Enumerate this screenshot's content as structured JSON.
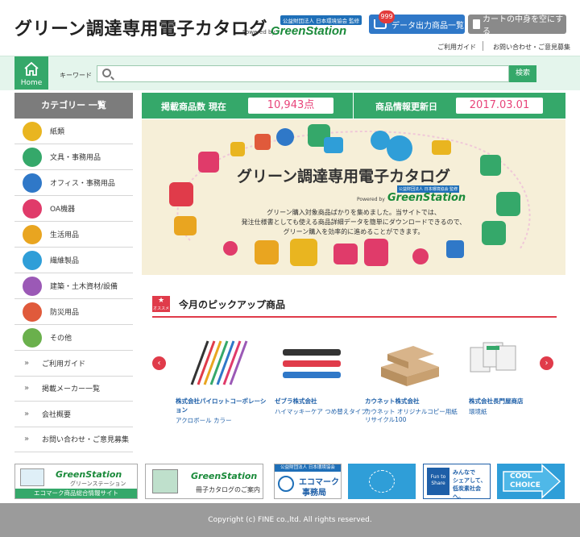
{
  "header": {
    "site_title": "グリーン調達専用電子カタログ",
    "powered_by": "Powered by",
    "brand": "GreenStation",
    "brand_org": "公益財団法人 日本環境協会 監修",
    "export_button": "データ出力商品一覧",
    "export_badge": "999",
    "empty_cart_button": "カートの中身を空にする",
    "link_guide": "ご利用ガイド",
    "link_contact": "お問い合わせ・ご意見募集"
  },
  "search": {
    "home_label": "Home",
    "keyword_label": "キーワード",
    "placeholder": "",
    "button": "検索"
  },
  "sidebar": {
    "heading": "カテゴリー 一覧",
    "categories": [
      {
        "label": "紙類",
        "color": "#e9b520"
      },
      {
        "label": "文具・事務用品",
        "color": "#35a86a"
      },
      {
        "label": "オフィス・事務用品",
        "color": "#2f78c8"
      },
      {
        "label": "OA機器",
        "color": "#e03b6a"
      },
      {
        "label": "生活用品",
        "color": "#e9a520"
      },
      {
        "label": "繊維製品",
        "color": "#2f9ed8"
      },
      {
        "label": "建築・土木資材/設備",
        "color": "#9b59b6"
      },
      {
        "label": "防災用品",
        "color": "#e05a3b"
      },
      {
        "label": "その他",
        "color": "#6ab04c"
      }
    ],
    "guides": [
      "ご利用ガイド",
      "掲載メーカー一覧",
      "会社概要",
      "お問い合わせ・ご意見募集"
    ]
  },
  "stats": {
    "count_label": "掲載商品数 現在",
    "count_value": "10,943点",
    "updated_label": "商品情報更新日",
    "updated_value": "2017.03.01"
  },
  "banner": {
    "title": "グリーン調達専用電子カタログ",
    "powered_by": "Powered by",
    "brand": "GreenStation",
    "brand_org": "公益財団法人 日本環境協会 監修",
    "line1": "グリーン購入対象商品ばかりを集めました。当サイトでは、",
    "line2": "発注仕様書としても使える商品詳細データを簡単にダウンロードできるので、",
    "line3": "グリーン購入を効率的に進めることができます。"
  },
  "pickup": {
    "badge": "オススメ",
    "title": "今月のピックアップ商品",
    "prev": "‹",
    "next": "›",
    "products": [
      {
        "vendor": "株式会社パイロットコーポレーション",
        "name": "アクロボール カラー"
      },
      {
        "vendor": "ゼブラ株式会社",
        "name": "ハイマッキーケア つめ替えタイプ"
      },
      {
        "vendor": "カウネット株式会社",
        "name": "カウネット オリジナルコピー用紙 リサイクル100"
      },
      {
        "vendor": "株式会社長門屋商店",
        "name": "環境紙"
      }
    ]
  },
  "footer_banners": {
    "b1_brand": "GreenStation",
    "b1_sub": "グリーンステーション",
    "b1_caption": "エコマーク商品総合情報サイト",
    "b2_brand": "GreenStation",
    "b2_caption": "冊子カタログのご案内",
    "b3_org": "公益財団法人 日本環境協会",
    "b3_title1": "エコマーク",
    "b3_title2": "事務局",
    "b5_line1": "みんなで",
    "b5_line2": "シェアして、",
    "b5_line3": "低炭素社会へ。",
    "b5_badge": "Fun to Share",
    "b6_line1": "COOL",
    "b6_line2": "CHOICE"
  },
  "footer": {
    "copyright": "Copyright (c) FINE co.,ltd. All rights reserved."
  }
}
